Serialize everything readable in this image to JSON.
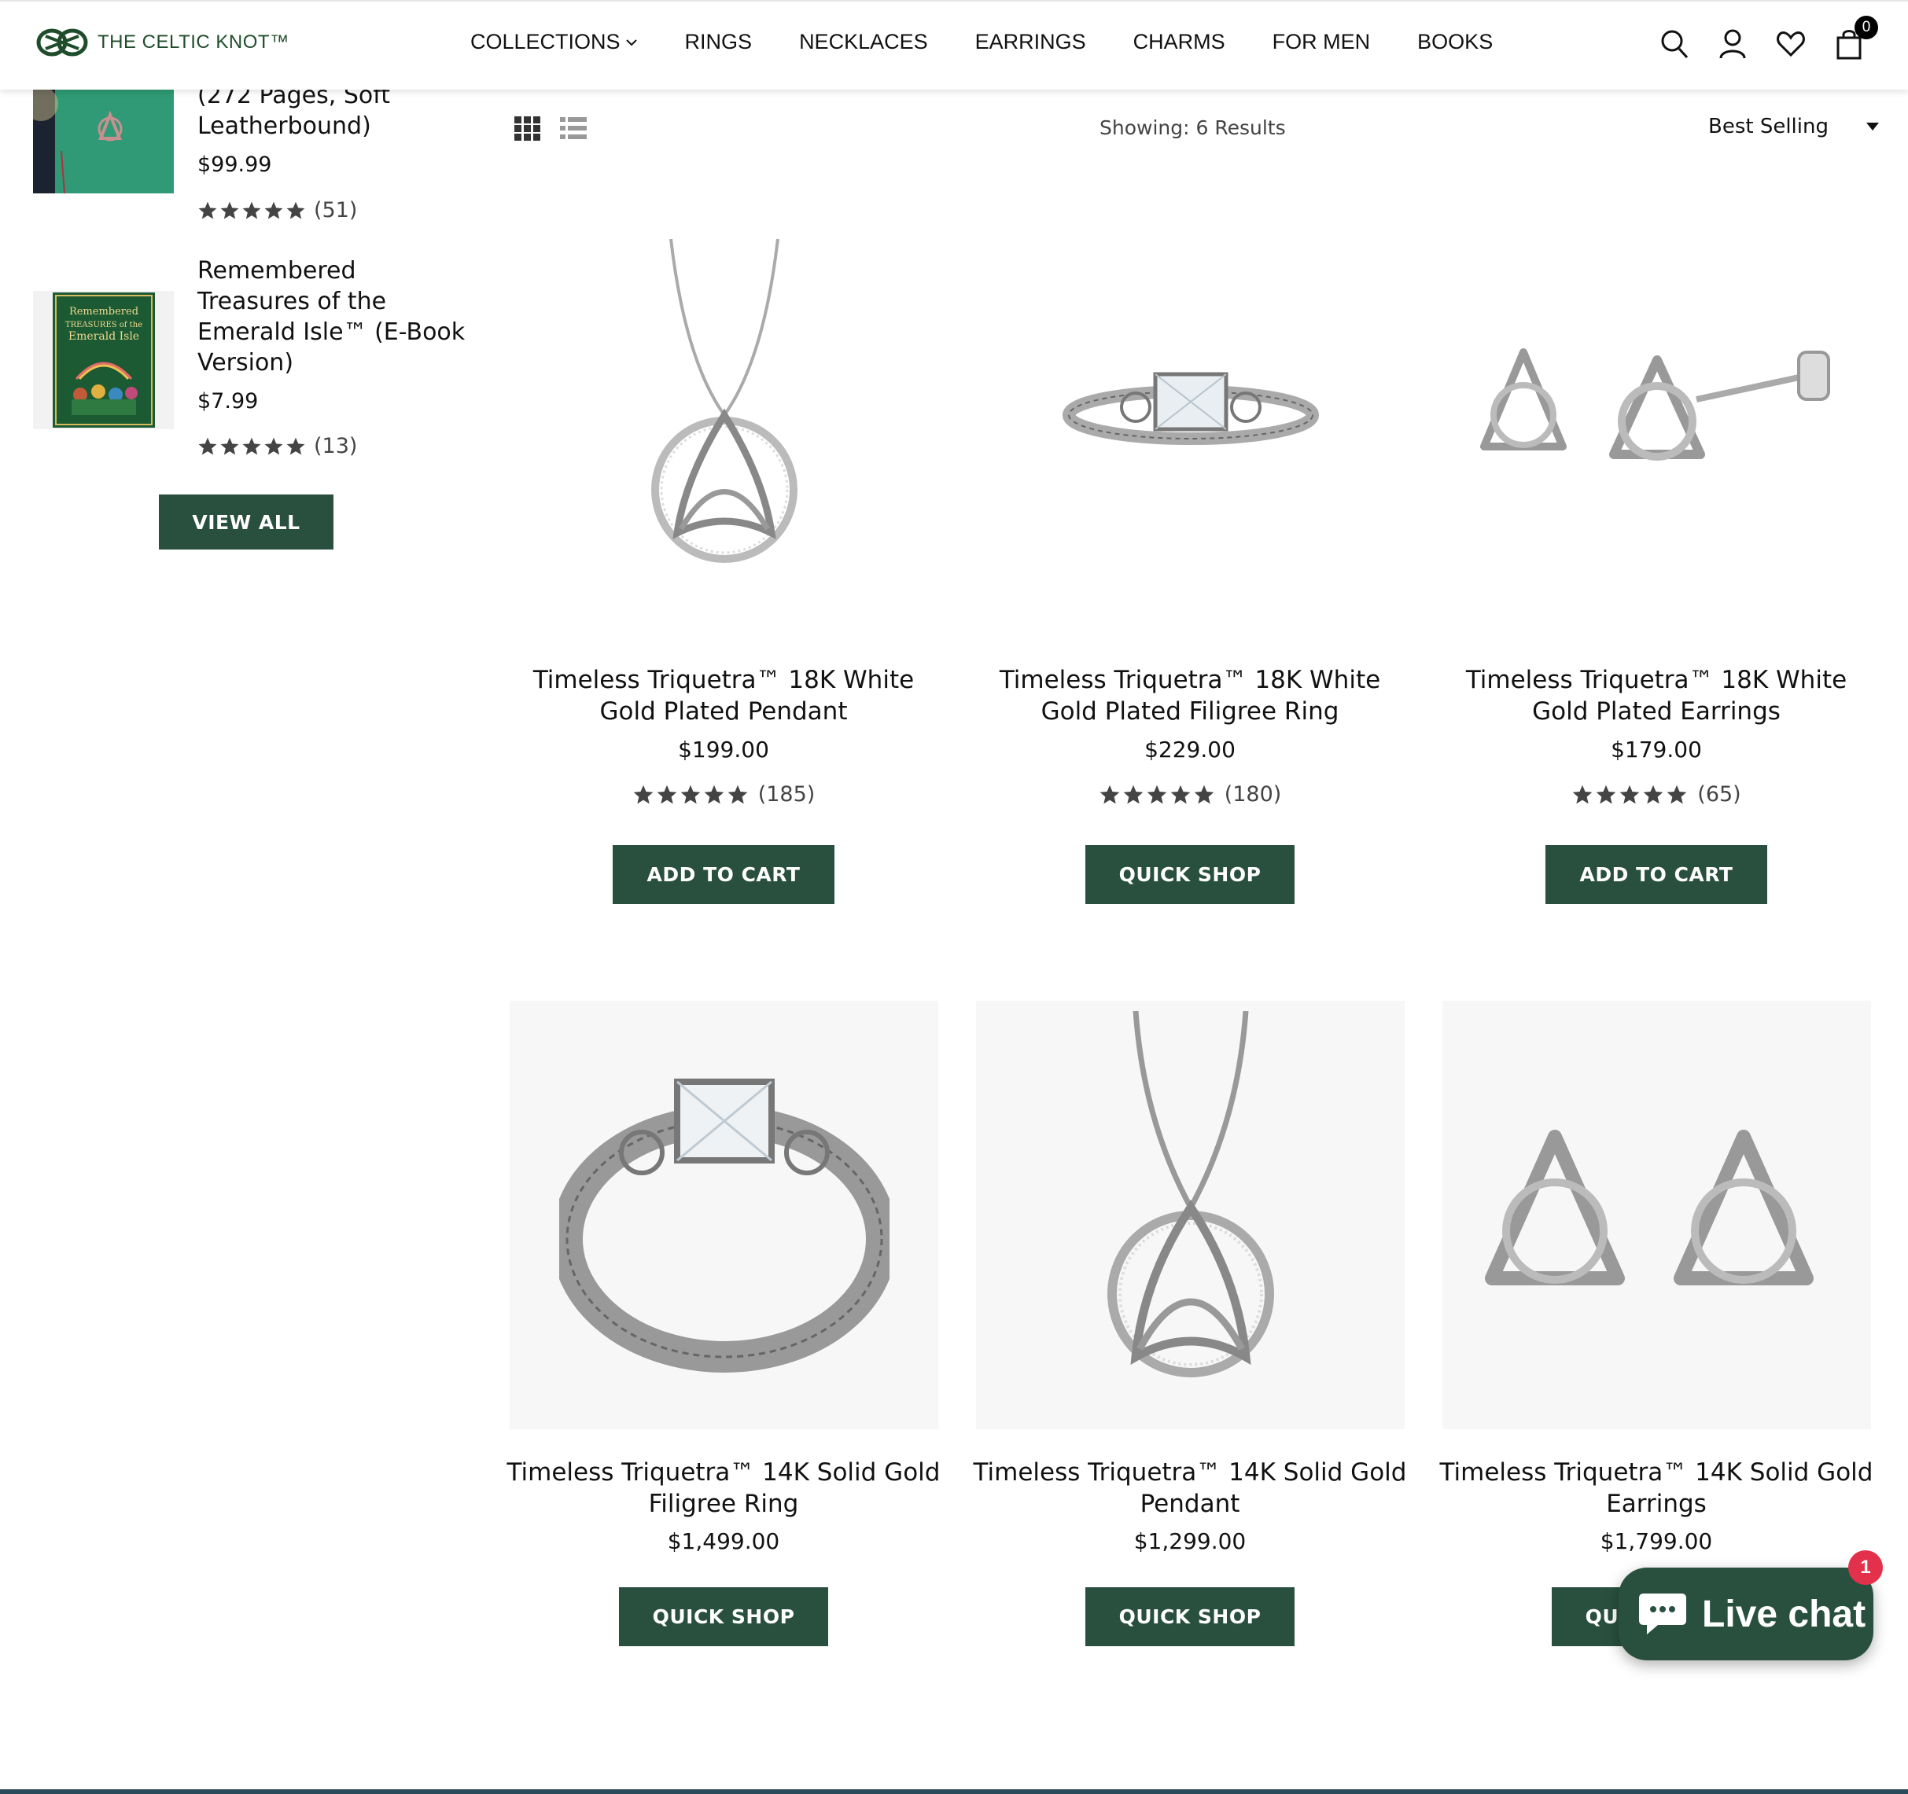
{
  "header": {
    "logo_text": "THE CELTIC KNOT™",
    "nav": [
      {
        "label": "COLLECTIONS"
      },
      {
        "label": "RINGS"
      },
      {
        "label": "NECKLACES"
      },
      {
        "label": "EARRINGS"
      },
      {
        "label": "CHARMS"
      },
      {
        "label": "FOR MEN"
      },
      {
        "label": "BOOKS"
      }
    ],
    "cart_count": "0"
  },
  "sidebar": {
    "items": [
      {
        "title": "(272 Pages, Soft Leatherbound)",
        "price": "$99.99",
        "review_count": "(51)",
        "rating": 5
      },
      {
        "title": "Remembered Treasures of the Emerald Isle™ (E-Book Version)",
        "price": "$7.99",
        "review_count": "(13)",
        "rating": 5
      }
    ],
    "view_all_label": "VIEW ALL",
    "book_cover_text": "Remembered Treasures of the Emerald Isle"
  },
  "toolbar": {
    "showing": "Showing: 6 Results",
    "sort_label": "Best Selling"
  },
  "products": [
    {
      "title": "Timeless Triquetra™ 18K White Gold Plated Pendant",
      "price": "$199.00",
      "review_count": "(185)",
      "rating": 5,
      "button": "ADD TO CART"
    },
    {
      "title": "Timeless Triquetra™ 18K White Gold Plated Filigree Ring",
      "price": "$229.00",
      "review_count": "(180)",
      "rating": 5,
      "button": "QUICK SHOP"
    },
    {
      "title": "Timeless Triquetra™ 18K White Gold Plated Earrings",
      "price": "$179.00",
      "review_count": "(65)",
      "rating": 5,
      "button": "ADD TO CART"
    },
    {
      "title": "Timeless Triquetra™ 14K Solid Gold Filigree Ring",
      "price": "$1,499.00",
      "button": "QUICK SHOP"
    },
    {
      "title": "Timeless Triquetra™ 14K Solid Gold Pendant",
      "price": "$1,299.00",
      "button": "QUICK SHOP"
    },
    {
      "title": "Timeless Triquetra™ 14K Solid Gold Earrings",
      "price": "$1,799.00",
      "button": "QUICK SHOP"
    }
  ],
  "chat": {
    "label": "Live chat",
    "badge": "1"
  },
  "colors": {
    "brand_green": "#29503f",
    "logo_green": "#1f4d2b",
    "chat_badge": "#e3304b"
  }
}
